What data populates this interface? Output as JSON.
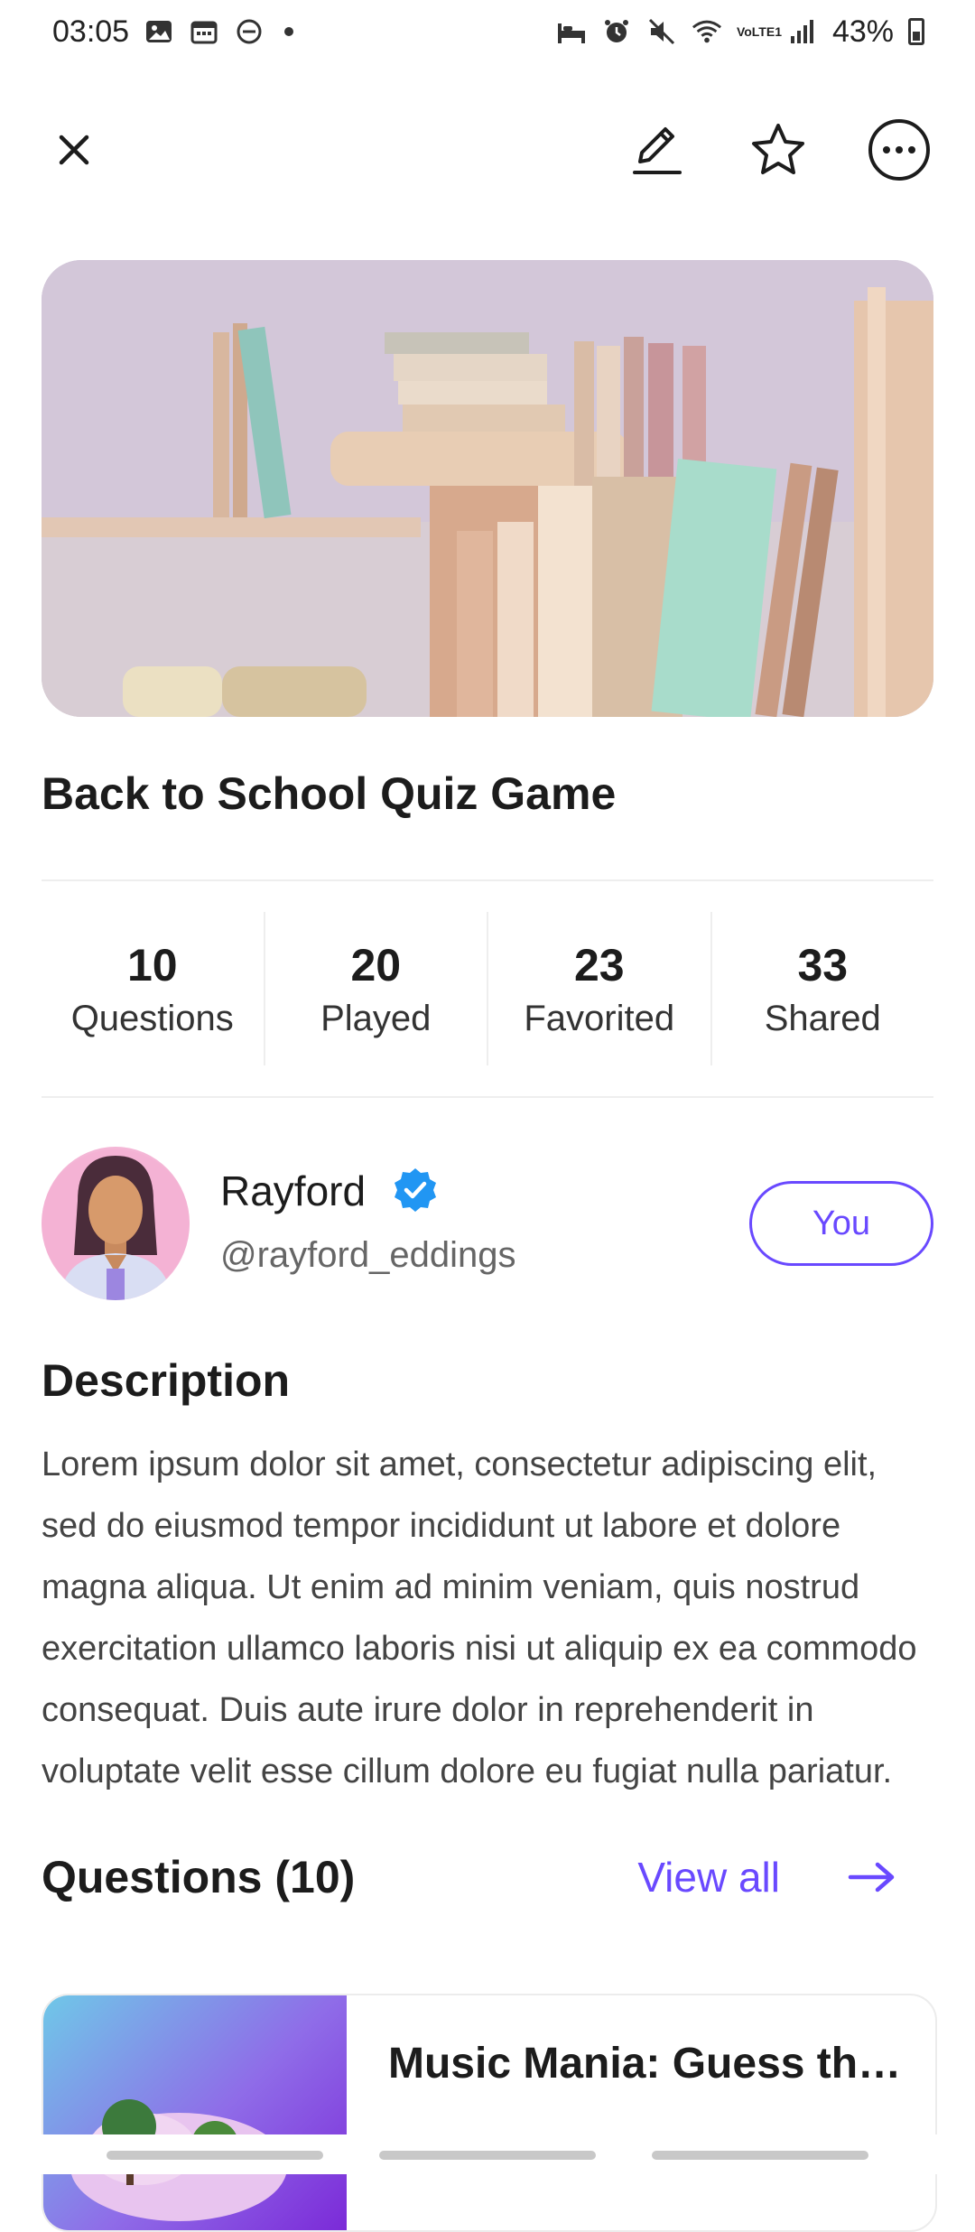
{
  "status": {
    "time": "03:05",
    "battery": "43%",
    "network": "VoLTE1"
  },
  "toolbar": {
    "close_icon": "close-icon",
    "edit_icon": "pencil-icon",
    "favorite_icon": "star-icon",
    "more_icon": "more-horizontal-icon"
  },
  "quiz": {
    "title": "Back to School Quiz Game",
    "cover_icon": "bookshelf-image"
  },
  "stats": [
    {
      "value": "10",
      "label": "Questions"
    },
    {
      "value": "20",
      "label": "Played"
    },
    {
      "value": "23",
      "label": "Favorited"
    },
    {
      "value": "33",
      "label": "Shared"
    }
  ],
  "author": {
    "name": "Rayford",
    "handle": "@rayford_eddings",
    "badge_icon": "verified-icon",
    "you_label": "You"
  },
  "description": {
    "heading": "Description",
    "text": "Lorem ipsum dolor sit amet, consectetur adipiscing elit, sed do eiusmod tempor incididunt ut labore et dolore magna aliqua. Ut enim ad minim veniam, quis nostrud exercitation ullamco laboris nisi ut aliquip ex ea commodo consequat. Duis aute irure dolor in reprehenderit in voluptate velit esse cillum dolore eu fugiat nulla pariatur."
  },
  "questions": {
    "heading": "Questions (10)",
    "view_all": "View all",
    "items": [
      {
        "title": "Music Mania: Guess the Song"
      }
    ]
  },
  "colors": {
    "accent": "#6949ff",
    "verified": "#2196f3"
  }
}
